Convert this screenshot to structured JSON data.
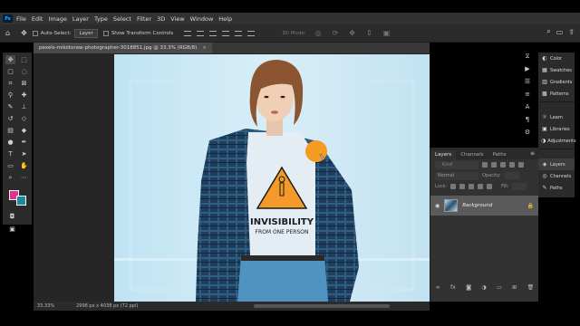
{
  "app": {
    "logo": "Ps"
  },
  "menu": [
    "File",
    "Edit",
    "Image",
    "Layer",
    "Type",
    "Select",
    "Filter",
    "3D",
    "View",
    "Window",
    "Help"
  ],
  "options": {
    "auto_select_label": "Auto-Select:",
    "auto_select_value": "Layer",
    "transform_label": "Show Transform Controls",
    "mode_3d": "3D Mode:"
  },
  "document": {
    "tab_title": "pexels-mikotoraw-photographer-3018851.jpg @ 33.3% (RGB/8)",
    "zoom": "33.33%",
    "size_info": "2998 px x 4038 px (72 ppi)"
  },
  "colors": {
    "foreground": "#e5338d",
    "background": "#1b8a9c",
    "cursor_dot": "#f59a23"
  },
  "photo": {
    "shirt_text_line1": "INVISIBILITY",
    "shirt_text_line2": "FROM ONE PERSON"
  },
  "layers": {
    "tabs": [
      "Layers",
      "Channels",
      "Paths"
    ],
    "search_placeholder": "Kind",
    "blend_mode": "Normal",
    "opacity_label": "Opacity:",
    "lock_label": "Lock:",
    "fill_label": "Fill:",
    "items": [
      {
        "name": "Background"
      }
    ]
  },
  "right_panel": {
    "group1": [
      "Color",
      "Swatches",
      "Gradients",
      "Patterns"
    ],
    "group2": [
      "Learn",
      "Libraries",
      "Adjustments"
    ],
    "group3": [
      "Layers",
      "Channels",
      "Paths"
    ]
  }
}
